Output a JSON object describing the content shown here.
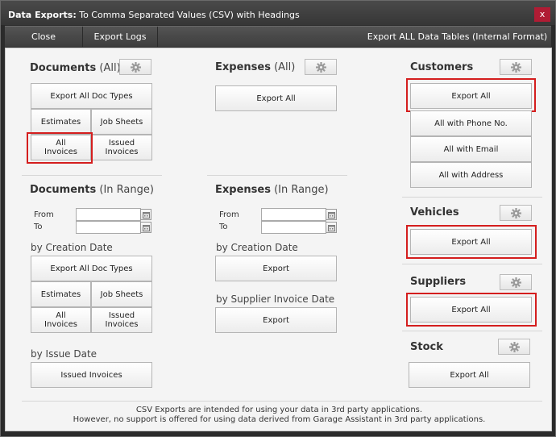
{
  "window": {
    "title_bold": "Data Exports:",
    "title_rest": " To Comma Separated Values (CSV) with Headings",
    "close_glyph": "x",
    "accent": "#b01c34"
  },
  "menubar": {
    "close": "Close",
    "export_logs": "Export Logs",
    "export_all_tables": "Export ALL Data Tables (Internal Format)"
  },
  "documents_all": {
    "title": "Documents",
    "suffix": " (All)",
    "gear_icon": "gear-icon",
    "export_all_doc_types": "Export All Doc Types",
    "estimates": "Estimates",
    "job_sheets": "Job Sheets",
    "all_invoices_1": "All",
    "all_invoices_2": "Invoices",
    "issued_invoices_1": "Issued",
    "issued_invoices_2": "Invoices"
  },
  "expenses_all": {
    "title": "Expenses",
    "suffix": " (All)",
    "gear_icon": "gear-icon",
    "export_all": "Export All"
  },
  "customers": {
    "title": "Customers",
    "gear_icon": "gear-icon",
    "export_all": "Export All",
    "with_phone": "All with Phone No.",
    "with_email": "All with Email",
    "with_address": "All with Address"
  },
  "documents_range": {
    "title": "Documents",
    "suffix": " (In Range)",
    "from": "From",
    "to": "To",
    "from_value": "",
    "to_value": "",
    "by_creation": "by Creation Date",
    "export_all_doc_types": "Export All Doc Types",
    "estimates": "Estimates",
    "job_sheets": "Job Sheets",
    "all_invoices_1": "All",
    "all_invoices_2": "Invoices",
    "issued_invoices_1": "Issued",
    "issued_invoices_2": "Invoices",
    "by_issue": "by Issue Date",
    "issued_invoices": "Issued Invoices"
  },
  "expenses_range": {
    "title": "Expenses",
    "suffix": " (In Range)",
    "from": "From",
    "to": "To",
    "from_value": "",
    "to_value": "",
    "by_creation": "by Creation Date",
    "export_creation": "Export",
    "by_supplier_invoice": "by Supplier Invoice Date",
    "export_supplier": "Export"
  },
  "vehicles": {
    "title": "Vehicles",
    "gear_icon": "gear-icon",
    "export_all": "Export All"
  },
  "suppliers": {
    "title": "Suppliers",
    "gear_icon": "gear-icon",
    "export_all": "Export All"
  },
  "stock": {
    "title": "Stock",
    "gear_icon": "gear-icon",
    "export_all": "Export All"
  },
  "footer": {
    "line1": "CSV Exports are intended for using your data in 3rd party applications.",
    "line2": "However, no support is offered for using data derived from Garage Assistant in 3rd party applications."
  },
  "highlight_color": "#d41e1e"
}
